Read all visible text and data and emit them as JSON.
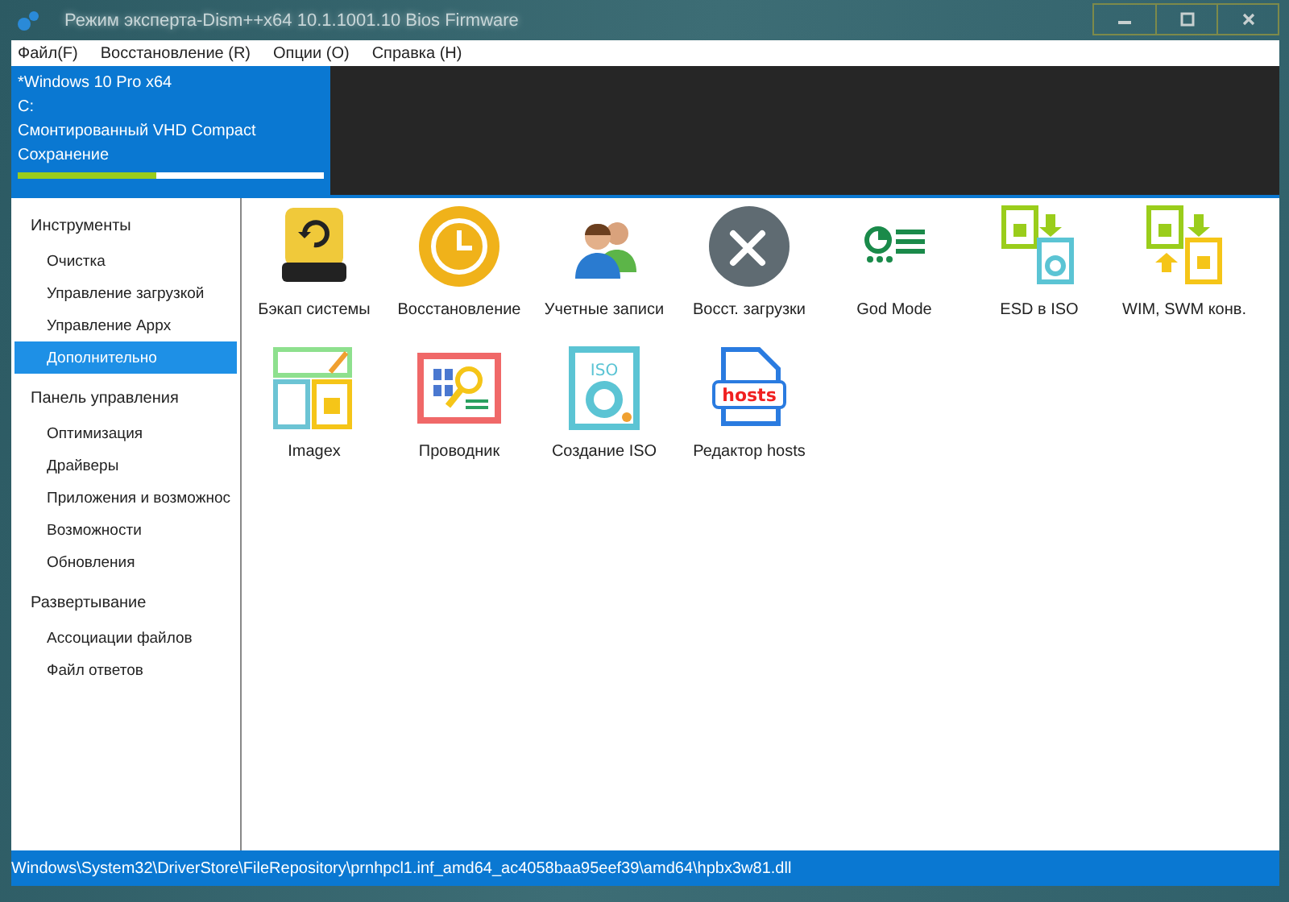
{
  "window": {
    "title": "Режим эксперта-Dism++x64 10.1.1001.10 Bios Firmware"
  },
  "menu": [
    "Файл(F)",
    "Восстановление (R)",
    "Опции (O)",
    "Справка (H)"
  ],
  "image": {
    "name": "*Windows 10 Pro x64",
    "drive": "C:",
    "state": "Смонтированный VHD Compact",
    "operation": "Сохранение",
    "level": 0.45
  },
  "sidebar": [
    {
      "label": "Инструменты",
      "children": [
        {
          "label": "Очистка",
          "selected": false
        },
        {
          "label": "Управление загрузкой",
          "selected": false
        },
        {
          "label": "Управление Appx",
          "selected": false
        },
        {
          "label": "Дополнительно",
          "selected": true
        }
      ]
    },
    {
      "label": "Панель управления",
      "children": [
        {
          "label": "Оптимизация",
          "selected": false
        },
        {
          "label": "Драйверы",
          "selected": false
        },
        {
          "label": "Приложения и возможнос",
          "selected": false
        },
        {
          "label": "Возможности",
          "selected": false
        },
        {
          "label": "Обновления",
          "selected": false
        }
      ]
    },
    {
      "label": "Развертывание",
      "children": [
        {
          "label": "Ассоциации файлов",
          "selected": false
        },
        {
          "label": "Файл ответов",
          "selected": false
        }
      ]
    }
  ],
  "tools": [
    {
      "kind": "backup",
      "label": "Бэкап системы"
    },
    {
      "kind": "restore",
      "label": "Восстановление"
    },
    {
      "kind": "accounts",
      "label": "Учетные записи"
    },
    {
      "kind": "bootfix",
      "label": "Восст. загрузки"
    },
    {
      "kind": "godmode",
      "label": "God Mode"
    },
    {
      "kind": "esdiso",
      "label": "ESD в ISO"
    },
    {
      "kind": "wimconv",
      "label": "WIM, SWM конв."
    },
    {
      "kind": "imagex",
      "label": "Imagex"
    },
    {
      "kind": "explorer",
      "label": "Проводник"
    },
    {
      "kind": "isocreate",
      "label": "Создание ISO",
      "icon_text": "ISO"
    },
    {
      "kind": "hosts",
      "label": "Редактор hosts",
      "icon_text": "hosts"
    }
  ],
  "status_bar": "Windows\\System32\\DriverStore\\FileRepository\\prnhpcl1.inf_amd64_ac4058baa95eef39\\amd64\\hpbx3w81.dll"
}
